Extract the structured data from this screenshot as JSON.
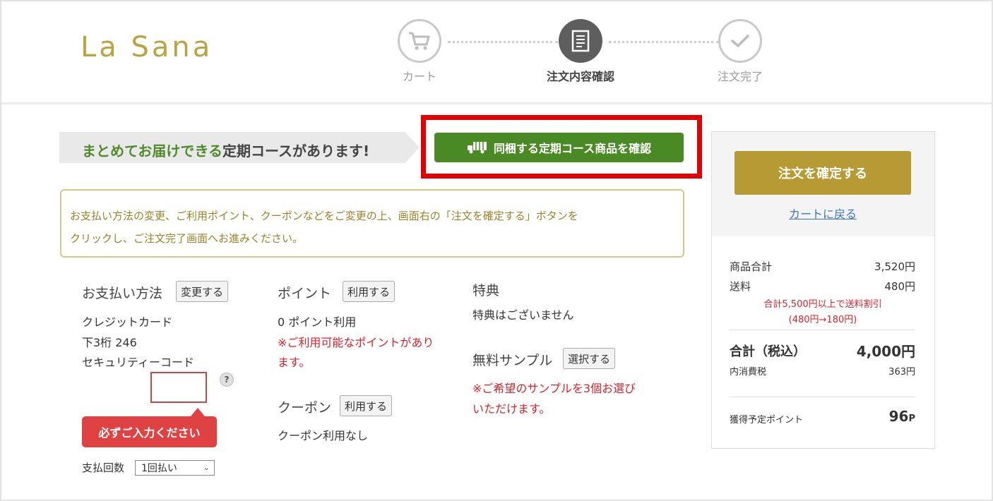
{
  "logo": "La Sana",
  "steps": [
    {
      "label": "カート",
      "icon": "cart-icon"
    },
    {
      "label": "注文内容確認",
      "icon": "document-icon"
    },
    {
      "label": "注文完了",
      "icon": "check-icon"
    }
  ],
  "banner": {
    "green_text": "まとめてお届けできる",
    "text": "定期コースがあります!",
    "button_label": "同梱する定期コース商品を確認"
  },
  "notice": {
    "line1": "お支払い方法の変更、ご利用ポイント、クーポンなどをご変更の上、画面右の「注文を確定する」ボタンを",
    "line2": "クリックし、ご注文完了画面へお進みください。"
  },
  "payment": {
    "title": "お支払い方法",
    "change_label": "変更する",
    "method": "クレジットカード",
    "last3": "下3桁 246",
    "security_label": "セキュリティーコード",
    "help": "?",
    "required_tooltip": "必ずご入力ください",
    "installments_label": "支払回数",
    "installments_value": "1回払い"
  },
  "points": {
    "title": "ポイント",
    "use_label": "利用する",
    "usage": "0 ポイント利用",
    "warning_line1": "※ご利用可能なポイントがあり",
    "warning_line2": "ます。"
  },
  "coupon": {
    "title": "クーポン",
    "use_label": "利用する",
    "status": "クーポン利用なし"
  },
  "benefits": {
    "title": "特典",
    "status": "特典はございません"
  },
  "sample": {
    "title": "無料サンプル",
    "select_label": "選択する",
    "warning_line1": "※ご希望のサンプルを3個お選び",
    "warning_line2": "いただけます。"
  },
  "summary": {
    "confirm_button": "注文を確定する",
    "back_link": "カートに戻る",
    "subtotal_label": "商品合計",
    "subtotal_value": "3,520円",
    "shipping_label": "送料",
    "shipping_value": "480円",
    "shipping_note_line1": "合計5,500円以上で送料割引",
    "shipping_note_line2": "(480円→180円)",
    "total_label": "合計（税込）",
    "total_value": "4,000円",
    "tax_label": "内消費税",
    "tax_value": "363円",
    "points_label": "獲得予定ポイント",
    "points_value": "96",
    "points_unit": "P"
  },
  "colors": {
    "logo_gold": "#b9a441",
    "confirm_gold": "#b69a34",
    "green": "#4a8a24",
    "highlight_red": "#e30000",
    "warning_red": "#d9222a",
    "link_blue": "#3a74c4"
  }
}
